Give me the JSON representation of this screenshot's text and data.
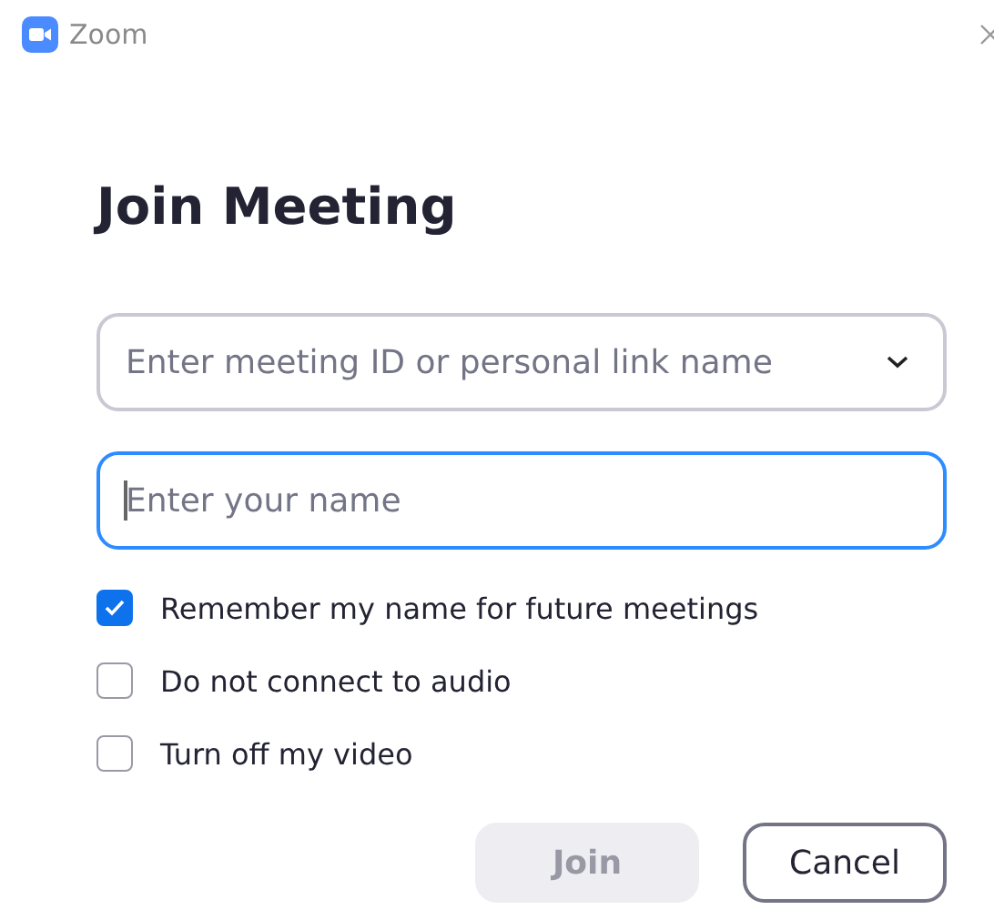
{
  "window": {
    "title": "Zoom"
  },
  "heading": "Join Meeting",
  "fields": [
    {
      "kind": "dropdown",
      "placeholder": "Enter meeting ID or personal link name",
      "focused": false
    },
    {
      "kind": "text",
      "placeholder": "Enter your name",
      "focused": true
    }
  ],
  "options": [
    {
      "label": "Remember my name for future meetings",
      "checked": true
    },
    {
      "label": "Do not connect to audio",
      "checked": false
    },
    {
      "label": "Turn off my video",
      "checked": false
    }
  ],
  "buttons": [
    {
      "label": "Join",
      "disabled": true
    },
    {
      "label": "Cancel",
      "disabled": false
    }
  ]
}
